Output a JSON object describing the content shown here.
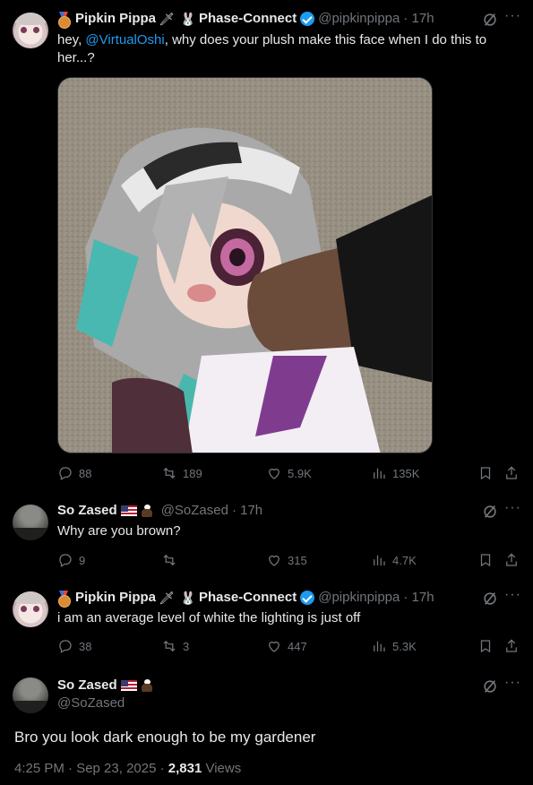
{
  "tweet1": {
    "display_name": "Pipkin Pippa",
    "org_name": "Phase-Connect",
    "handle": "@pipkinpippa",
    "time": "· 17h",
    "text_prefix": "hey, ",
    "mention": "@VirtualOshi",
    "text_suffix": ", why does your plush make this face when I do this to her...?",
    "replies": "88",
    "reposts": "189",
    "likes": "5.9K",
    "views": "135K"
  },
  "reply1": {
    "display_name": "So Zased",
    "handle": "@SoZased",
    "time": "· 17h",
    "text": "Why are you brown?",
    "replies": "9",
    "reposts": "",
    "likes": "315",
    "views": "4.7K"
  },
  "reply2": {
    "display_name": "Pipkin Pippa",
    "org_name": "Phase-Connect",
    "handle": "@pipkinpippa",
    "time": "· 17h",
    "text": "i am an average level of white the lighting is just off",
    "replies": "38",
    "reposts": "3",
    "likes": "447",
    "views": "5.3K"
  },
  "main": {
    "display_name": "So Zased",
    "handle": "@SoZased",
    "text": "Bro you look dark enough to be my gardener",
    "timestamp": "4:25 PM · Sep 23, 2025 · ",
    "views_count": "2,831",
    "views_label": " Views"
  },
  "colors": {
    "accent": "#1d9bf0",
    "muted": "#71767b",
    "text": "#e7e9ea",
    "background": "#000000"
  },
  "icons": [
    "medal-icon",
    "sword-icon",
    "rabbit-icon",
    "verified-badge-icon",
    "flag-us-icon",
    "eagle-icon",
    "grok-icon",
    "more-icon",
    "reply-icon",
    "repost-icon",
    "like-icon",
    "views-icon",
    "bookmark-icon",
    "share-icon"
  ]
}
